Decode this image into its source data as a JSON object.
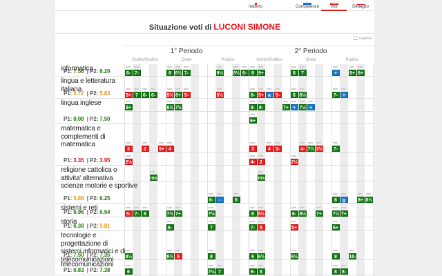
{
  "nav": {
    "items": [
      {
        "label": "Indietro",
        "icon": "back-icon",
        "color": "#e02020"
      },
      {
        "label": "Competenze",
        "icon": "competenze-icon",
        "color": "#1a6fc4"
      },
      {
        "label": "Voti",
        "icon": "voti-icon",
        "color": "#e02020",
        "active": true
      },
      {
        "label": "Dettaglio",
        "icon": "dettaglio-icon",
        "color": "#e02020"
      }
    ]
  },
  "title": {
    "prefix": "Situazione voti di",
    "student": "LUCONI SIMONE"
  },
  "legenda": "Legenda",
  "periods": [
    "1° Periodo",
    "2° Periodo"
  ],
  "categories": [
    "Scritto/Grafico",
    "Orale",
    "Pratico"
  ],
  "colors": {
    "g": "#137a13",
    "r": "#ee1c1c",
    "b": "#1a7cc4",
    "good": "#2c7a14",
    "warn": "#f7941d",
    "bad": "#e8141c"
  },
  "subjects": [
    {
      "name": "informatica",
      "p1": "7.56",
      "p2": "8.29",
      "p1c": "good",
      "p2c": "good",
      "lines": [
        {
          "h": 18,
          "cells": {
            "0": "g:8-",
            "1": "g:7-",
            "5": "g:8",
            "6": "g:6½",
            "7": "g:7-",
            "11": "g:9½",
            "13": "g:6½",
            "14": "g:9-",
            "15": "g:8",
            "16": "g:9+",
            "20": "g:8",
            "21": "g:7",
            "25": "b:+",
            "27": "g:9+",
            "28": "g:8+"
          }
        }
      ]
    },
    {
      "name": "lingua e letteratura italiana",
      "p1": "5.72",
      "p2": "5.83",
      "p1c": "warn",
      "p2c": "warn",
      "lines": [
        {
          "h": 32,
          "cells": {
            "0": "r:5+",
            "1": "g:7",
            "2": "g:6-",
            "3": "g:6-",
            "5": "r:5½",
            "6": "g:6+",
            "7": "r:5-",
            "11": "r:5½",
            "15": "g:6-",
            "16": "r:5+",
            "17": "b:a",
            "18": "r:5-",
            "20": "g:6",
            "21": "g:6½",
            "25": "g:7-",
            "26": "b:+"
          }
        }
      ]
    },
    {
      "name": "lingua inglese",
      "p1": "8.08",
      "p2": "7.50",
      "p1c": "good",
      "p2c": "good",
      "lines": [
        {
          "h": 19,
          "cells": {
            "0": "g:8+",
            "5": "g:8½",
            "6": "g:7½",
            "15": "g:8-",
            "16": "g:9-",
            "19": "g:7+",
            "20": "b:+",
            "21": "g:7½",
            "22": "b:+"
          }
        },
        {
          "h": 18,
          "cells": {
            "15": "g:6+"
          }
        }
      ]
    },
    {
      "name": "matematica e complementi di matematica",
      "p1": "3.35",
      "p2": "3.95",
      "p1c": "bad",
      "p2c": "bad",
      "lines": [
        {
          "h": 42,
          "cells": {
            "0": "r:3",
            "2": "r:2",
            "4": "r:5+",
            "5": "r:4",
            "15": "r:3",
            "17": "r:4",
            "18": "r:3-",
            "21": "r:4-",
            "22": "g:7½",
            "23": "r:3½",
            "25": "g:7-"
          }
        },
        {
          "h": 18,
          "cells": {
            "0": "r:2½",
            "15": "r:4-",
            "16": "r:2",
            "20": "r:2½"
          }
        }
      ]
    },
    {
      "name": "religione cattolica o attivita' alternativa",
      "lines": [
        {
          "h": 23,
          "cells": {
            "3": "g:ms",
            "16": "g:ms"
          }
        }
      ]
    },
    {
      "name": "scienze motorie e sportive",
      "nowrap": true,
      "p1": "5.88",
      "p2": "6.25",
      "p1c": "warn",
      "p2c": "good",
      "lines": [
        {
          "h": 32,
          "cells": {
            "10": "g:6-",
            "11": "b:-",
            "13": "g:6",
            "25": "g:8",
            "26": "b:g",
            "28": "g:8+",
            "29": "g:8½"
          }
        }
      ]
    },
    {
      "name": "sistemi e reti",
      "p1": "6.96",
      "p2": "6.54",
      "p1c": "good",
      "p2c": "good",
      "lines": [
        {
          "h": 20,
          "cells": {
            "0": "r:5-",
            "1": "g:7-",
            "2": "g:8",
            "5": "g:7½",
            "6": "g:7+",
            "10": "g:7½",
            "15": "g:8",
            "16": "r:5½",
            "20": "g:6-",
            "21": "g:8½",
            "23": "g:7+",
            "25": "g:7½",
            "26": "g:7+"
          }
        }
      ]
    },
    {
      "name": "storia",
      "p1": "6.38",
      "p2": "5.81",
      "p1c": "good",
      "p2c": "warn",
      "lines": [
        {
          "h": 20,
          "cells": {
            "5": "g:6-",
            "10": "g:7",
            "15": "g:7-",
            "16": "r:5",
            "20": "r:5+",
            "25": "g:6+"
          }
        }
      ]
    },
    {
      "name": "tecnologie e progettazione di sistemi informatici e di telecomunicazioni",
      "p1": "7.50",
      "p2": "7.35",
      "p1c": "good",
      "p2c": "good",
      "lines": [
        {
          "h": 42,
          "cells": {
            "0": "g:8½",
            "5": "g:8½",
            "6": "r:5",
            "10": "g:8",
            "15": "g:6",
            "16": "g:6½",
            "20": "g:6½",
            "25": "g:8",
            "27": "g:10-"
          }
        }
      ]
    },
    {
      "name": "telecomunicazioni",
      "p1": "6.83",
      "p2": "7.38",
      "p1c": "good",
      "p2c": "good",
      "lines": [
        {
          "h": 22,
          "cells": {
            "0": "g:6",
            "10": "g:7½",
            "11": "g:7",
            "15": "g:6-",
            "16": "g:8",
            "25": "g:8",
            "26": "g:8-"
          }
        }
      ]
    }
  ]
}
